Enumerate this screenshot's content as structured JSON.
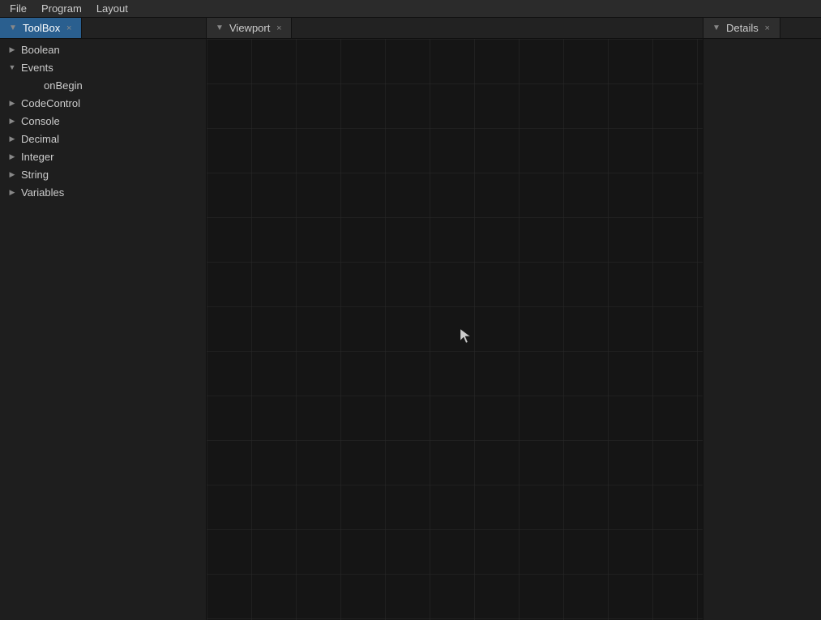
{
  "menubar": {
    "items": [
      {
        "label": "File",
        "id": "file"
      },
      {
        "label": "Program",
        "id": "program"
      },
      {
        "label": "Layout",
        "id": "layout"
      }
    ]
  },
  "toolbox": {
    "tab_label": "ToolBox",
    "tab_icon": "▼",
    "close_label": "×",
    "tree": [
      {
        "id": "boolean",
        "label": "Boolean",
        "indent": 0,
        "arrow": "▶",
        "arrow_type": "collapsed"
      },
      {
        "id": "events",
        "label": "Events",
        "indent": 0,
        "arrow": "▼",
        "arrow_type": "expanded"
      },
      {
        "id": "onbegin",
        "label": "onBegin",
        "indent": 2,
        "arrow": "",
        "arrow_type": "none"
      },
      {
        "id": "codecontrol",
        "label": "CodeControl",
        "indent": 0,
        "arrow": "▶",
        "arrow_type": "collapsed"
      },
      {
        "id": "console",
        "label": "Console",
        "indent": 0,
        "arrow": "▶",
        "arrow_type": "collapsed"
      },
      {
        "id": "decimal",
        "label": "Decimal",
        "indent": 0,
        "arrow": "▶",
        "arrow_type": "collapsed"
      },
      {
        "id": "integer",
        "label": "Integer",
        "indent": 0,
        "arrow": "▶",
        "arrow_type": "collapsed"
      },
      {
        "id": "string",
        "label": "String",
        "indent": 0,
        "arrow": "▶",
        "arrow_type": "collapsed"
      },
      {
        "id": "variables",
        "label": "Variables",
        "indent": 0,
        "arrow": "▶",
        "arrow_type": "collapsed"
      }
    ]
  },
  "viewport": {
    "tab_label": "Viewport",
    "tab_icon": "▼",
    "close_label": "×"
  },
  "details": {
    "tab_label": "Details",
    "tab_icon": "▼",
    "close_label": "×"
  },
  "colors": {
    "menu_bg": "#2b2b2b",
    "panel_bg": "#1e1e1e",
    "tab_active_bg": "#1e1e1e",
    "tab_inactive_bg": "#2e2e2e",
    "viewport_bg": "#151515",
    "grid_line": "#2a2a2a",
    "toolbox_active": "#2a5f8f"
  }
}
